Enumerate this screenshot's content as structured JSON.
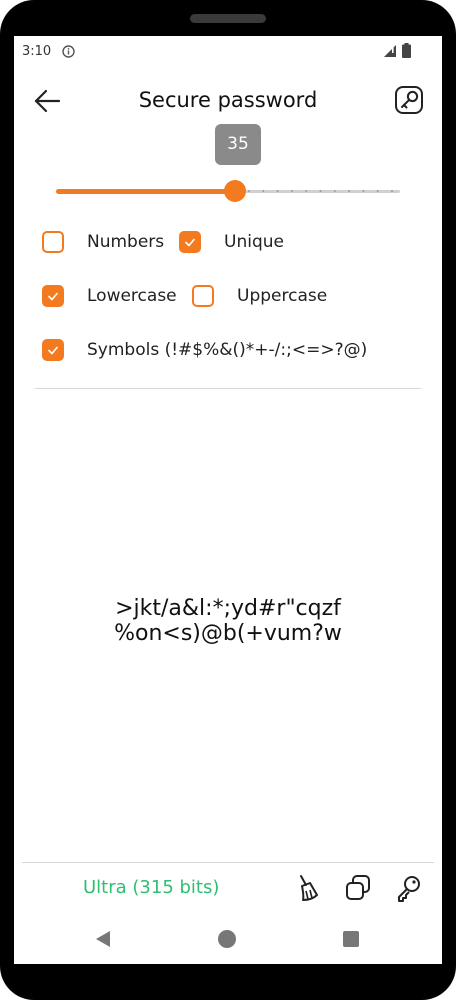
{
  "status_bar": {
    "time": "3:10",
    "info_icon": "info-circle-icon",
    "signal_icon": "signal-icon",
    "battery_icon": "battery-icon"
  },
  "app_bar": {
    "title": "Secure password",
    "back_icon": "arrow-left-icon",
    "action_icon": "key-icon"
  },
  "length": {
    "value": "35",
    "slider_fraction": 0.52
  },
  "options": {
    "numbers": {
      "label": "Numbers",
      "checked": false
    },
    "unique": {
      "label": "Unique",
      "checked": true
    },
    "lowercase": {
      "label": "Lowercase",
      "checked": true
    },
    "uppercase": {
      "label": "Uppercase",
      "checked": false
    },
    "symbols": {
      "label": "Symbols (!#$%&()*+-/:;<=>?@)",
      "checked": true
    }
  },
  "password": {
    "line1": ">jkt/a&l:*;yd#r\"cqzf",
    "line2": "%on<s)@b(+vum?w"
  },
  "footer": {
    "strength": "Ultra (315 bits)",
    "clear_icon": "broom-icon",
    "copy_icon": "copy-icon",
    "generate_icon": "key-icon"
  },
  "nav_bar": {
    "back_icon": "triangle-back-icon",
    "home_icon": "circle-home-icon",
    "recents_icon": "square-recents-icon"
  },
  "colors": {
    "accent": "#f47a1f",
    "strength": "#2fbf71",
    "badge": "#8a8a8a"
  }
}
